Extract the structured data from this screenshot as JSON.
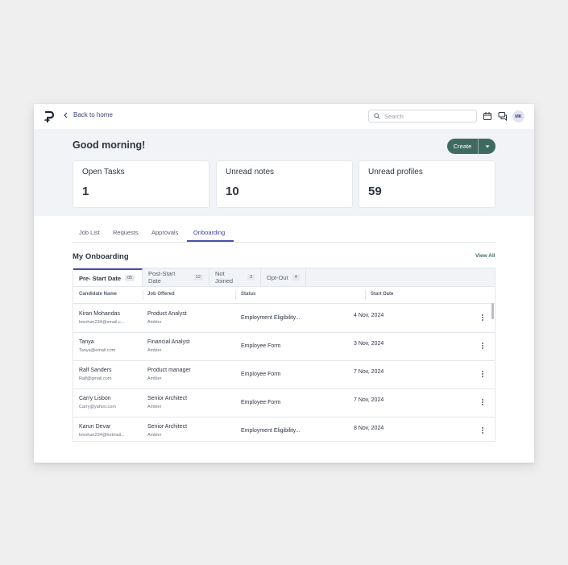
{
  "topbar": {
    "back_label": "Back to home",
    "search_placeholder": "Search",
    "avatar_initials": "MK"
  },
  "header": {
    "greeting": "Good morning!",
    "create_label": "Create"
  },
  "stats": [
    {
      "label": "Open Tasks",
      "value": "1"
    },
    {
      "label": "Unread notes",
      "value": "10"
    },
    {
      "label": "Unread profiles",
      "value": "59"
    }
  ],
  "tabs": [
    {
      "label": "Job List"
    },
    {
      "label": "Requests"
    },
    {
      "label": "Approvals"
    },
    {
      "label": "Onboarding"
    }
  ],
  "section": {
    "title": "My Onboarding",
    "view_all": "View All"
  },
  "subtabs": [
    {
      "label": "Pre- Start Date",
      "count": "05"
    },
    {
      "label": "Post-Start Date",
      "count": "12"
    },
    {
      "label": "Not Joined",
      "count": "3"
    },
    {
      "label": "Opt-Out",
      "count": "4"
    }
  ],
  "columns": {
    "candidate": "Candidate Name",
    "job": "Job Offered",
    "status": "Status",
    "start": "Start Date"
  },
  "rows": [
    {
      "name": "Kiran Mohandas",
      "email": "kmohan234@email.c...",
      "job": "Product Analyst",
      "company": "Ambler",
      "status": "Employment Eligibility...",
      "date": "4 Nov, 2024"
    },
    {
      "name": "Tanya",
      "email": "Tanya@email.com",
      "job": "Financial Analyst",
      "company": "Ambler",
      "status": "Employee Form",
      "date": "3 Nov, 2024"
    },
    {
      "name": "Ralf Sanders",
      "email": "Ralf@gmail.com",
      "job": "Product manager",
      "company": "Ambler",
      "status": "Employee Form",
      "date": "7 Nov, 2024"
    },
    {
      "name": "Carry Lisbon",
      "email": "Carry@yahoo.com",
      "job": "Senior Architect",
      "company": "Ambler",
      "status": "Employee Form",
      "date": "7 Nov, 2024"
    },
    {
      "name": "Karun Devar",
      "email": "kmohan234@hotmail...",
      "job": "Senior Architect",
      "company": "Ambler",
      "status": "Employment Eligibility...",
      "date": "8 Nov, 2024"
    }
  ],
  "colors": {
    "accent": "#4a4fa8",
    "brand_button": "#3f6b5f",
    "band": "#f1f3f6"
  }
}
